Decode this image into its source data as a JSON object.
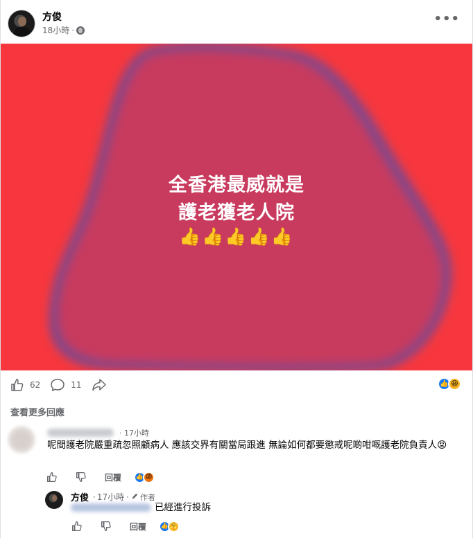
{
  "post": {
    "author": "方俊",
    "time": "18小時",
    "meta_sep": "·",
    "more_label": "•••",
    "image": {
      "background": "#f7373d",
      "blob_color": "#c83a5e",
      "line1": "全香港最威就是",
      "line2": "護老獲老人院",
      "emojis": "👍👍👍👍👍"
    },
    "likes": "62",
    "comments": "11"
  },
  "see_more": "查看更多回應",
  "comment": {
    "time": "17小時",
    "text": "呢間護老院嚴重疏忽照顧病人 應該交界有關當局跟進 無論如何都要懲戒呢啲咁嘅護老院負責人😡",
    "reply_label": "回覆"
  },
  "reply": {
    "author": "方俊",
    "sep": "·",
    "time": "17小時",
    "badge": "作者",
    "text": "已經進行投訴",
    "reply_label": "回覆"
  },
  "colors": {
    "like_blue": "#1877f2",
    "muted": "#65676b"
  },
  "icons": {
    "like": "thumbs-up-icon",
    "comment": "comment-icon",
    "share": "share-icon",
    "dislike": "thumbs-down-icon"
  }
}
